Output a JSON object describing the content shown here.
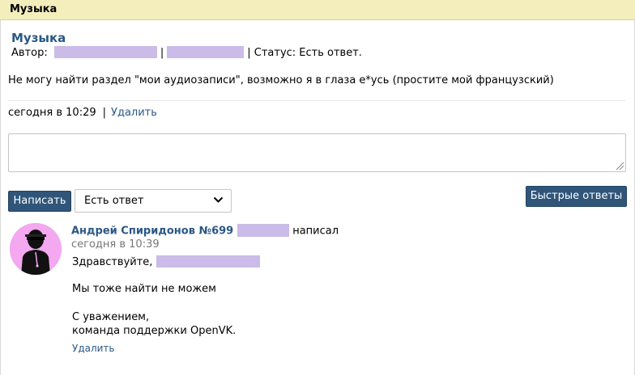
{
  "header": {
    "title": "Музыка"
  },
  "topic": {
    "title": "Музыка",
    "author_label": "Автор:",
    "separator": "|",
    "status_label": "| Статус: Есть ответ.",
    "body": "Не могу найти раздел \"мои аудиозаписи\", возможно я в глаза е*усь (простите мой французский)",
    "time": "сегодня в 10:29",
    "time_separator": "|",
    "delete_label": "Удалить"
  },
  "reply_form": {
    "textarea_value": "",
    "submit_label": "Написать",
    "status_select_value": "Есть ответ",
    "quick_answers_label": "Быстрые ответы"
  },
  "answer": {
    "author_name": "Андрей Спиридонов №699",
    "wrote_label": "написал",
    "time": "сегодня в 10:39",
    "greeting": "Здравствуйте,",
    "line1": "Мы тоже найти не можем",
    "line2": "С уважением,",
    "line3": "команда поддержки OpenVK.",
    "delete_label": "Удалить"
  },
  "colors": {
    "header_bg": "#f4eebd",
    "link": "#2a5885",
    "button_bg": "#2f5579",
    "redaction": "#cbbbe8",
    "avatar_bg": "#f3a8f0"
  },
  "icons": {
    "select_arrow": "chevron-down-icon",
    "textarea_resize": "resize-grip-icon",
    "avatar": "agent-avatar-icon"
  }
}
